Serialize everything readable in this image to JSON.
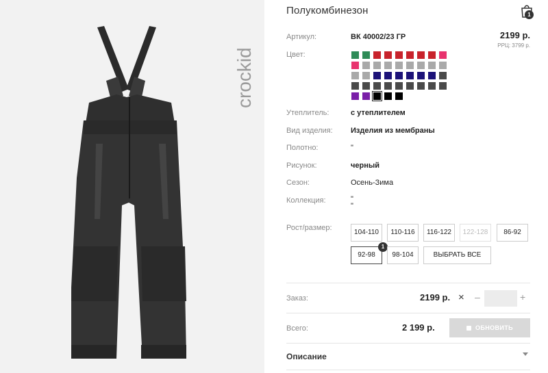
{
  "brand": {
    "logo_text": "crockid"
  },
  "product": {
    "title": "Полукомбинезон",
    "price": "2199 р.",
    "rrp": "РРЦ: 3799 р."
  },
  "cart": {
    "count": "1",
    "icon": "shopping-bag-icon"
  },
  "attributes": {
    "article_label": "Артикул:",
    "article_value": "ВК 40002/23 ГР",
    "color_label": "Цвет:",
    "insulation_label": "Утеплитель:",
    "insulation_value": "с утеплителем",
    "type_label": "Вид изделия:",
    "type_value": "Изделия из мембраны",
    "fabric_label": "Полотно:",
    "fabric_value": "\"",
    "pattern_label": "Рисунок:",
    "pattern_value": "черный",
    "season_label": "Сезон:",
    "season_value": "Осень-Зима",
    "collection_label": "Коллекция:",
    "collection_value_1": "\"",
    "collection_value_2": "\""
  },
  "swatches": [
    "#2e8b57",
    "#2e8b57",
    "#c8232c",
    "#c8232c",
    "#c8232c",
    "#c8232c",
    "#c8232c",
    "#c8232c",
    "#e8336e",
    "#e8336e",
    "#a9a9a9",
    "#a9a9a9",
    "#a9a9a9",
    "#a9a9a9",
    "#a9a9a9",
    "#a9a9a9",
    "#a9a9a9",
    "#a9a9a9",
    "#a9a9a9",
    "#a9a9a9",
    "#1c1278",
    "#1c1278",
    "#1c1278",
    "#1c1278",
    "#1c1278",
    "#1c1278",
    "#4a4a4a",
    "#4a4a4a",
    "#4a4a4a",
    "#4a4a4a",
    "#4a4a4a",
    "#4a4a4a",
    "#4a4a4a",
    "#4a4a4a",
    "#4a4a4a",
    "#4a4a4a",
    "#7a1fa8",
    "#7a1fa8",
    "#000000",
    "#000000",
    "#000000"
  ],
  "selected_swatch_index": 38,
  "sizes": {
    "label": "Рост/размер:",
    "options": [
      "104-110",
      "110-116",
      "116-122",
      "122-128",
      "86-92",
      "92-98",
      "98-104"
    ],
    "disabled": [
      "122-128"
    ],
    "selected": "92-98",
    "selected_badge": "1",
    "select_all_label": "ВЫБРАТЬ ВСЕ"
  },
  "order": {
    "label": "Заказ:",
    "price": "2199 р.",
    "times": "×",
    "minus": "–",
    "plus": "+",
    "qty": ""
  },
  "total": {
    "label": "Всего:",
    "value": "2 199 р.",
    "update_label": "ОБНОВИТЬ"
  },
  "description": {
    "label": "Описание"
  }
}
